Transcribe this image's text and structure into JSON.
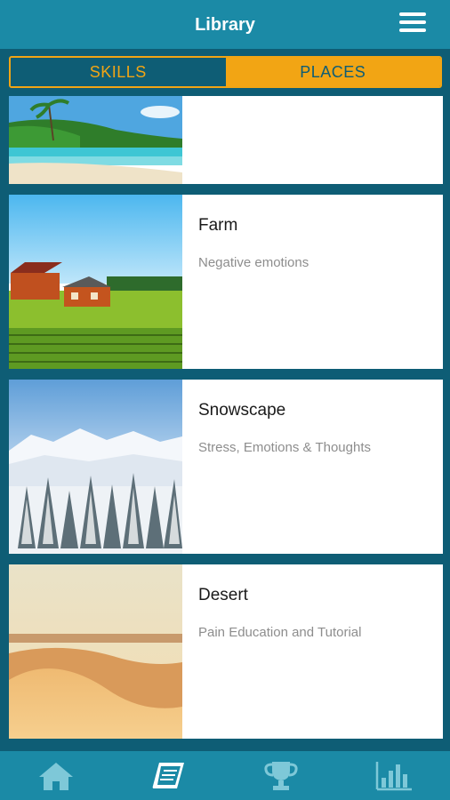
{
  "header": {
    "title": "Library",
    "menu_icon": "hamburger-menu-icon"
  },
  "tabs": [
    {
      "label": "SKILLS",
      "active": true
    },
    {
      "label": "PLACES",
      "active": false
    }
  ],
  "places": [
    {
      "title": "",
      "subtitle": "",
      "image": "tropical-beach-image"
    },
    {
      "title": "Farm",
      "subtitle": "Negative emotions",
      "image": "farm-field-image"
    },
    {
      "title": "Snowscape",
      "subtitle": "Stress, Emotions & Thoughts",
      "image": "snowy-mountains-image"
    },
    {
      "title": "Desert",
      "subtitle": "Pain Education and Tutorial",
      "image": "desert-dunes-image"
    }
  ],
  "bottom_nav": [
    {
      "icon": "home-icon",
      "active": false
    },
    {
      "icon": "library-book-icon",
      "active": true
    },
    {
      "icon": "trophy-icon",
      "active": false
    },
    {
      "icon": "stats-chart-icon",
      "active": false
    }
  ],
  "colors": {
    "header": "#1b8aa6",
    "background": "#0e5d75",
    "accent": "#f2a514",
    "icon_inactive": "#7ec8d8",
    "icon_active": "#ffffff"
  }
}
